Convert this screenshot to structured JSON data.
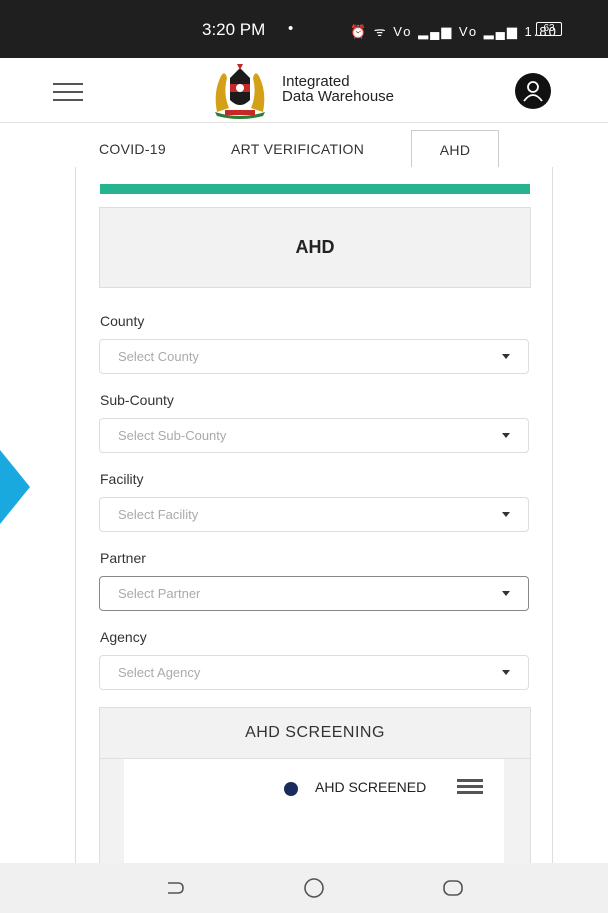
{
  "status_bar": {
    "time": "3:20 PM",
    "dot": "•",
    "icons": "⏰ ᯤ Vo ▂▄▆ Vo ▂▄▆ 1.80",
    "battery": "63"
  },
  "header": {
    "title_line1": "Integrated",
    "title_line2": "Data Warehouse",
    "menu_icon": "hamburger-icon",
    "avatar_icon": "user-icon"
  },
  "tabs": [
    {
      "label": "COVID-19"
    },
    {
      "label": "ART VERIFICATION"
    },
    {
      "label": "AHD",
      "active": true
    }
  ],
  "panel": {
    "card_title": "AHD",
    "accent_color": "#26b38f",
    "filters": [
      {
        "label": "County",
        "placeholder": "Select County"
      },
      {
        "label": "Sub-County",
        "placeholder": "Select Sub-County"
      },
      {
        "label": "Facility",
        "placeholder": "Select Facility"
      },
      {
        "label": "Partner",
        "placeholder": "Select Partner"
      },
      {
        "label": "Agency",
        "placeholder": "Select Agency"
      }
    ],
    "screening": {
      "header": "AHD SCREENING",
      "legend_label": "AHD SCREENED",
      "legend_color": "#1a2b5e"
    }
  },
  "navbar": {
    "back_icon": "back-icon",
    "home_icon": "home-icon",
    "recents_icon": "recents-icon"
  }
}
